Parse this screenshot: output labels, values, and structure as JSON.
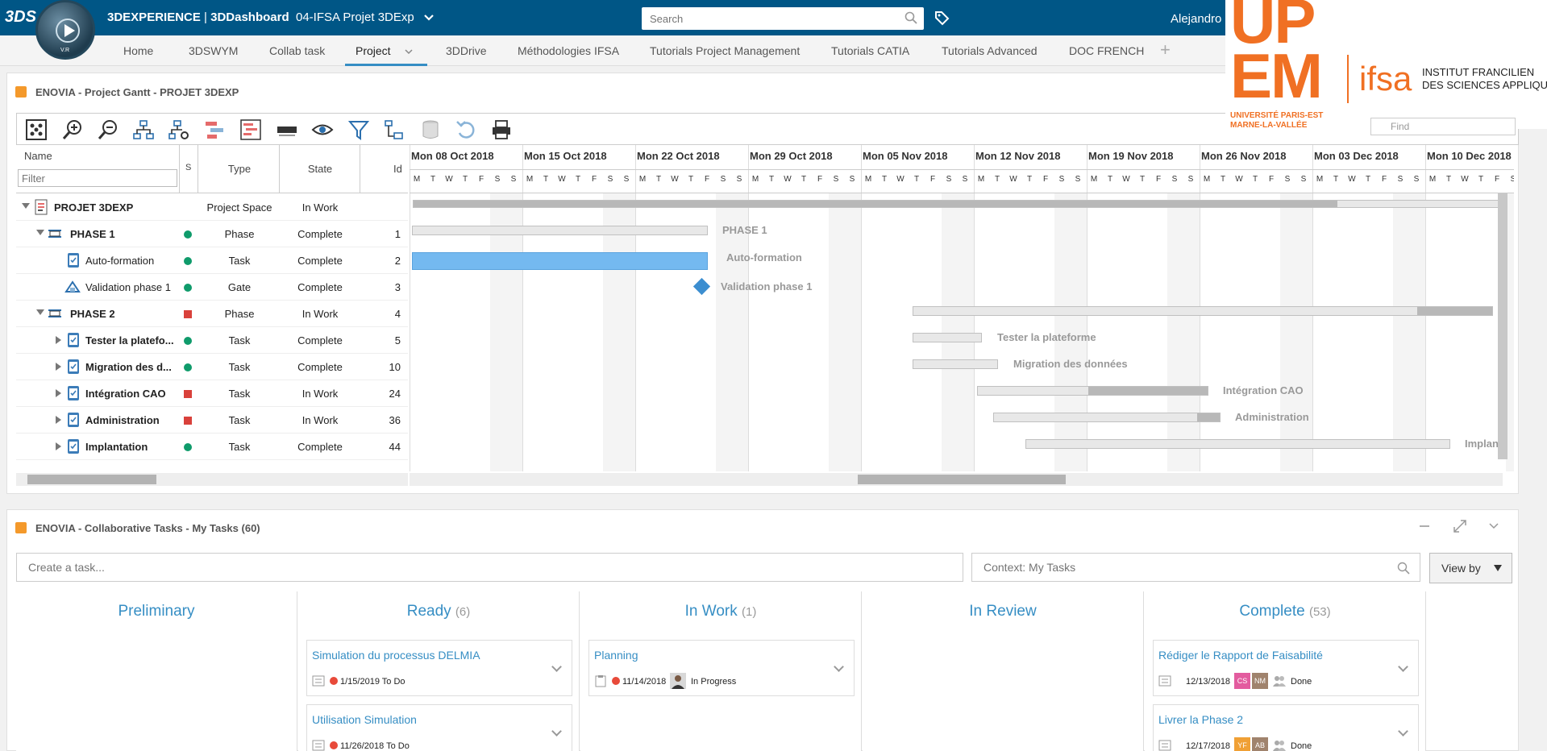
{
  "topbar": {
    "logo": "3DS",
    "compass_label": "V.R",
    "brand_strong": "3DEXPERIENCE",
    "separator": " | ",
    "app_name": "3DDashboard",
    "dashboard_name": "04-IFSA Projet 3DExp",
    "search_placeholder": "Search",
    "user": "Alejandro",
    "compass_button": "compass"
  },
  "tabs": [
    {
      "label": "Home"
    },
    {
      "label": "3DSWYM"
    },
    {
      "label": "Collab task"
    },
    {
      "label": "Project"
    },
    {
      "label": "3DDrive"
    },
    {
      "label": "Méthodologies IFSA"
    },
    {
      "label": "Tutorials Project Management"
    },
    {
      "label": "Tutorials CATIA"
    },
    {
      "label": "Tutorials Advanced"
    },
    {
      "label": "DOC FRENCH"
    }
  ],
  "tab_plus": "+",
  "logo_overlay": {
    "upem_main": "UP EM",
    "upem_sub1": "UNIVERSITÉ PARIS-EST",
    "upem_sub2": "MARNE-LA-VALLÉE",
    "ifsa": "ifsa",
    "ifsa_line1": "INSTITUT FRANCILIEN",
    "ifsa_line2": "DES SCIENCES APPLIQUÉES",
    "find_placeholder": "Find"
  },
  "gantt": {
    "title": "ENOVIA - Project Gantt - PROJET 3DEXP",
    "columns": {
      "name": "Name",
      "s": "S",
      "type": "Type",
      "state": "State",
      "id": "Id"
    },
    "filter_placeholder": "Filter",
    "rows": [
      {
        "name": "PROJET 3DEXP",
        "type": "Project Space",
        "state": "In Work",
        "id": "",
        "bold": true
      },
      {
        "name": "PHASE 1",
        "type": "Phase",
        "state": "Complete",
        "id": "1",
        "bold": true
      },
      {
        "name": "Auto-formation",
        "type": "Task",
        "state": "Complete",
        "id": "2",
        "bold": false
      },
      {
        "name": "Validation phase 1",
        "type": "Gate",
        "state": "Complete",
        "id": "3",
        "bold": false
      },
      {
        "name": "PHASE 2",
        "type": "Phase",
        "state": "In Work",
        "id": "4",
        "bold": true
      },
      {
        "name": "Tester la platefo...",
        "type": "Task",
        "state": "Complete",
        "id": "5",
        "bold": true
      },
      {
        "name": "Migration des d...",
        "type": "Task",
        "state": "Complete",
        "id": "10",
        "bold": true
      },
      {
        "name": "Intégration CAO",
        "type": "Task",
        "state": "In Work",
        "id": "24",
        "bold": true
      },
      {
        "name": "Administration",
        "type": "Task",
        "state": "In Work",
        "id": "36",
        "bold": true
      },
      {
        "name": "Implantation",
        "type": "Task",
        "state": "Complete",
        "id": "44",
        "bold": true
      }
    ],
    "weeks": [
      "Mon 08 Oct 2018",
      "Mon 15 Oct 2018",
      "Mon 22 Oct 2018",
      "Mon 29 Oct 2018",
      "Mon 05 Nov 2018",
      "Mon 12 Nov 2018",
      "Mon 19 Nov 2018",
      "Mon 26 Nov 2018",
      "Mon 03 Dec 2018",
      "Mon 10 Dec 2018"
    ],
    "days": [
      "M",
      "T",
      "W",
      "T",
      "F",
      "S",
      "S"
    ],
    "bar_labels": {
      "phase1": "PHASE 1",
      "autoformation": "Auto-formation",
      "validation": "Validation phase 1",
      "tester": "Tester la plateforme",
      "migration": "Migration des données",
      "integration": "Intégration CAO",
      "administration": "Administration",
      "implantation": "Implan"
    },
    "colors": {
      "green": "#0f9b6b",
      "red": "#d9413b",
      "blue_bar": "#74b9f0",
      "gate": "#3c8ed0"
    }
  },
  "tasks": {
    "title": "ENOVIA - Collaborative Tasks - My Tasks (60)",
    "create_placeholder": "Create a task...",
    "context_placeholder": "Context: My Tasks",
    "view_by": "View by",
    "columns": [
      {
        "title": "Preliminary",
        "count": ""
      },
      {
        "title": "Ready",
        "count": "(6)"
      },
      {
        "title": "In Work",
        "count": "(1)"
      },
      {
        "title": "In Review",
        "count": ""
      },
      {
        "title": "Complete",
        "count": "(53)"
      }
    ],
    "cards": {
      "ready1": {
        "title": "Simulation du processus DELMIA",
        "date": "1/15/2019",
        "status": "To Do"
      },
      "ready2": {
        "title": "Utilisation Simulation",
        "date": "11/26/2018",
        "status": "To Do"
      },
      "work1": {
        "title": "Planning",
        "date": "11/14/2018",
        "status": "In Progress"
      },
      "complete1": {
        "title": "Rédiger le Rapport de Faisabilité",
        "date": "12/13/2018",
        "i1": "CS",
        "i2": "NM",
        "status": "Done"
      },
      "complete2": {
        "title": "Livrer la Phase 2",
        "date": "12/17/2018",
        "i1": "YF",
        "i2": "AB",
        "status": "Done"
      }
    }
  }
}
